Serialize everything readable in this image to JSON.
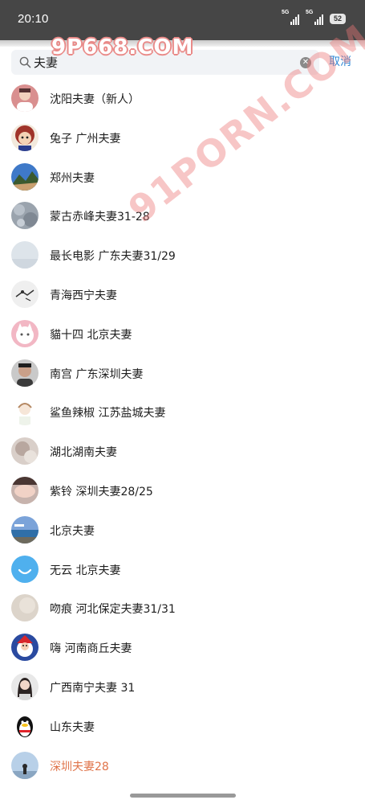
{
  "status_bar": {
    "time": "20:10",
    "signal_1": "5G",
    "signal_2": "5G",
    "battery": "52"
  },
  "search": {
    "query": "夫妻",
    "cancel_label": "取消"
  },
  "watermarks": {
    "top": "9P668.COM",
    "diagonal": "91PORN.COM"
  },
  "results": [
    {
      "name": "沈阳夫妻（新人）",
      "avatar": "portrait-red-background",
      "highlight": false
    },
    {
      "name": "兔子 广州夫妻",
      "avatar": "cartoon-character",
      "highlight": false
    },
    {
      "name": "郑州夫妻",
      "avatar": "mountain-landscape",
      "highlight": false
    },
    {
      "name": "蒙古赤峰夫妻31-28",
      "avatar": "gray-texture",
      "highlight": false
    },
    {
      "name": "最长电影  广东夫妻31/29",
      "avatar": "pale-sky",
      "highlight": false
    },
    {
      "name": "青海西宁夫妻",
      "avatar": "bird-sketch",
      "highlight": false
    },
    {
      "name": "貓十四 北京夫妻",
      "avatar": "white-cat",
      "highlight": false
    },
    {
      "name": "南宫  广东深圳夫妻",
      "avatar": "man-portrait",
      "highlight": false
    },
    {
      "name": "鲨鱼辣椒 江苏盐城夫妻",
      "avatar": "anime-sketch",
      "highlight": false
    },
    {
      "name": "湖北湖南夫妻",
      "avatar": "blurred-photo",
      "highlight": false
    },
    {
      "name": "紫铃 深圳夫妻28/25",
      "avatar": "woman-lying",
      "highlight": false
    },
    {
      "name": "北京夫妻",
      "avatar": "seaside-landscape",
      "highlight": false
    },
    {
      "name": "无云 北京夫妻",
      "avatar": "blue-smile",
      "highlight": false
    },
    {
      "name": "吻痕 河北保定夫妻31/31",
      "avatar": "beige-blur",
      "highlight": false
    },
    {
      "name": "嗨 河南商丘夫妻",
      "avatar": "santa-cartoon",
      "highlight": false
    },
    {
      "name": "广西南宁夫妻 31",
      "avatar": "woman-portrait",
      "highlight": false
    },
    {
      "name": "山东夫妻",
      "avatar": "qq-penguin",
      "highlight": false
    },
    {
      "name": "深圳夫妻28",
      "avatar": "silhouette-sky",
      "highlight": true
    }
  ]
}
